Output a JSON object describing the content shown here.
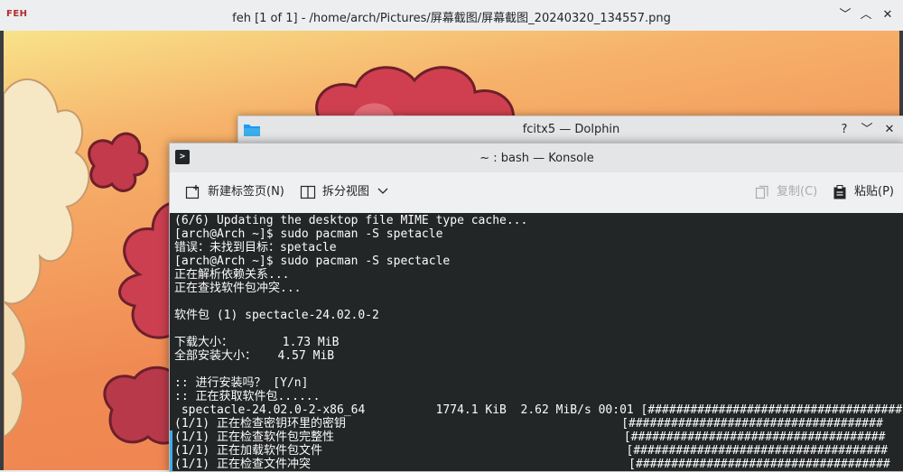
{
  "feh": {
    "logo": "FEH",
    "title": "feh [1 of 1] - /home/arch/Pictures/屏幕截图/屏幕截图_20240320_134557.png",
    "buttons": {
      "minimize": "﹀",
      "maximize": "︿",
      "close": "✕"
    }
  },
  "dolphin": {
    "title": "fcitx5 — Dolphin",
    "buttons": {
      "help": "?",
      "minimize": "﹀",
      "close": "✕"
    }
  },
  "konsole": {
    "title": "~ : bash — Konsole",
    "toolbar": {
      "new_tab": "新建标签页(N)",
      "split_view": "拆分视图",
      "copy": "复制(C)",
      "paste": "粘贴(P)"
    },
    "lines": [
      "(6/6) Updating the desktop file MIME type cache...",
      "[arch@Arch ~]$ sudo pacman -S spetacle",
      "错误：未找到目标：spetacle",
      "[arch@Arch ~]$ sudo pacman -S spectacle",
      "正在解析依赖关系...",
      "正在查找软件包冲突...",
      "",
      "软件包 (1) spectacle-24.02.0-2",
      "",
      "下载大小：       1.73 MiB",
      "全部安装大小：   4.57 MiB",
      "",
      ":: 进行安装吗？ [Y/n]",
      ":: 正在获取软件包......",
      " spectacle-24.02.0-2-x86_64          1774.1 KiB  2.62 MiB/s 00:01 [####################################",
      "(1/1) 正在检查密钥环里的密钥                                       [####################################",
      "(1/1) 正在检查软件包完整性                                         [####################################",
      "(1/1) 正在加载软件包文件                                           [####################################",
      "(1/1) 正在检查文件冲突                                             [####################################"
    ]
  },
  "colors": {
    "terminal_bg": "#232627",
    "terminal_fg": "#fcfcfc",
    "accent": "#3daee9",
    "feh_logo": "#b42a2a"
  }
}
